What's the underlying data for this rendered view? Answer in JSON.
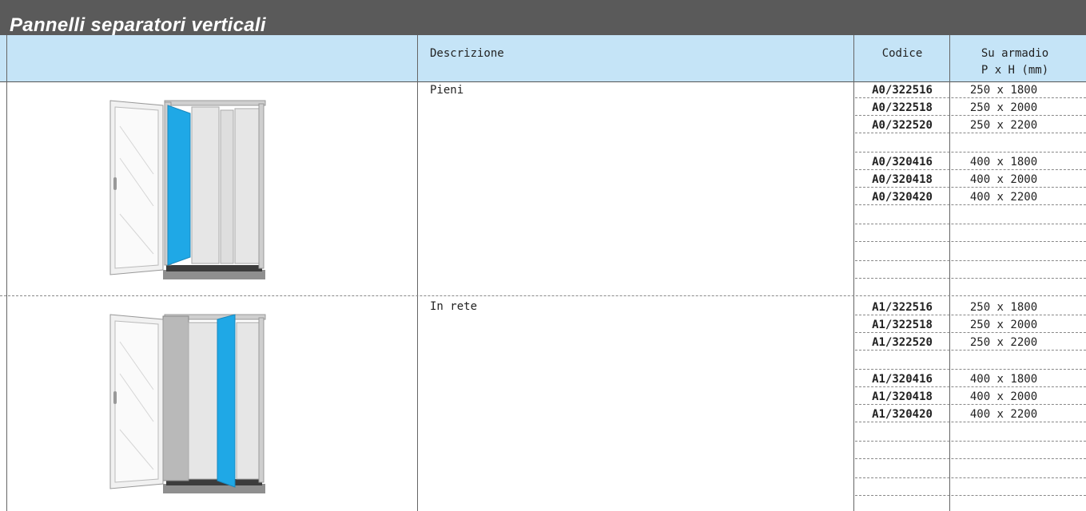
{
  "title": "Pannelli separatori verticali",
  "header": {
    "description": "Descrizione",
    "code": "Codice",
    "cabinet_line1": "Su armadio",
    "cabinet_line2": "P x H (mm)"
  },
  "sections": [
    {
      "description": "Pieni",
      "image": "cabinet-solid-panel-illustration",
      "rows": [
        {
          "code": "A0/322516",
          "dims": "250 x 1800"
        },
        {
          "code": "A0/322518",
          "dims": "250 x 2000"
        },
        {
          "code": "A0/322520",
          "dims": "250 x 2200"
        },
        {
          "code": "",
          "dims": ""
        },
        {
          "code": "A0/320416",
          "dims": "400 x 1800"
        },
        {
          "code": "A0/320418",
          "dims": "400 x 2000"
        },
        {
          "code": "A0/320420",
          "dims": "400 x 2200"
        }
      ]
    },
    {
      "description": "In rete",
      "image": "cabinet-mesh-panel-illustration",
      "rows": [
        {
          "code": "A1/322516",
          "dims": "250 x 1800"
        },
        {
          "code": "A1/322518",
          "dims": "250 x 2000"
        },
        {
          "code": "A1/322520",
          "dims": "250 x 2200"
        },
        {
          "code": "",
          "dims": ""
        },
        {
          "code": "A1/320416",
          "dims": "400 x 1800"
        },
        {
          "code": "A1/320418",
          "dims": "400 x 2000"
        },
        {
          "code": "A1/320420",
          "dims": "400 x 2200"
        }
      ]
    }
  ],
  "colors": {
    "title_bar": "#5a5a5a",
    "header_bg": "#c5e4f7",
    "panel_highlight": "#1fa8e6"
  }
}
